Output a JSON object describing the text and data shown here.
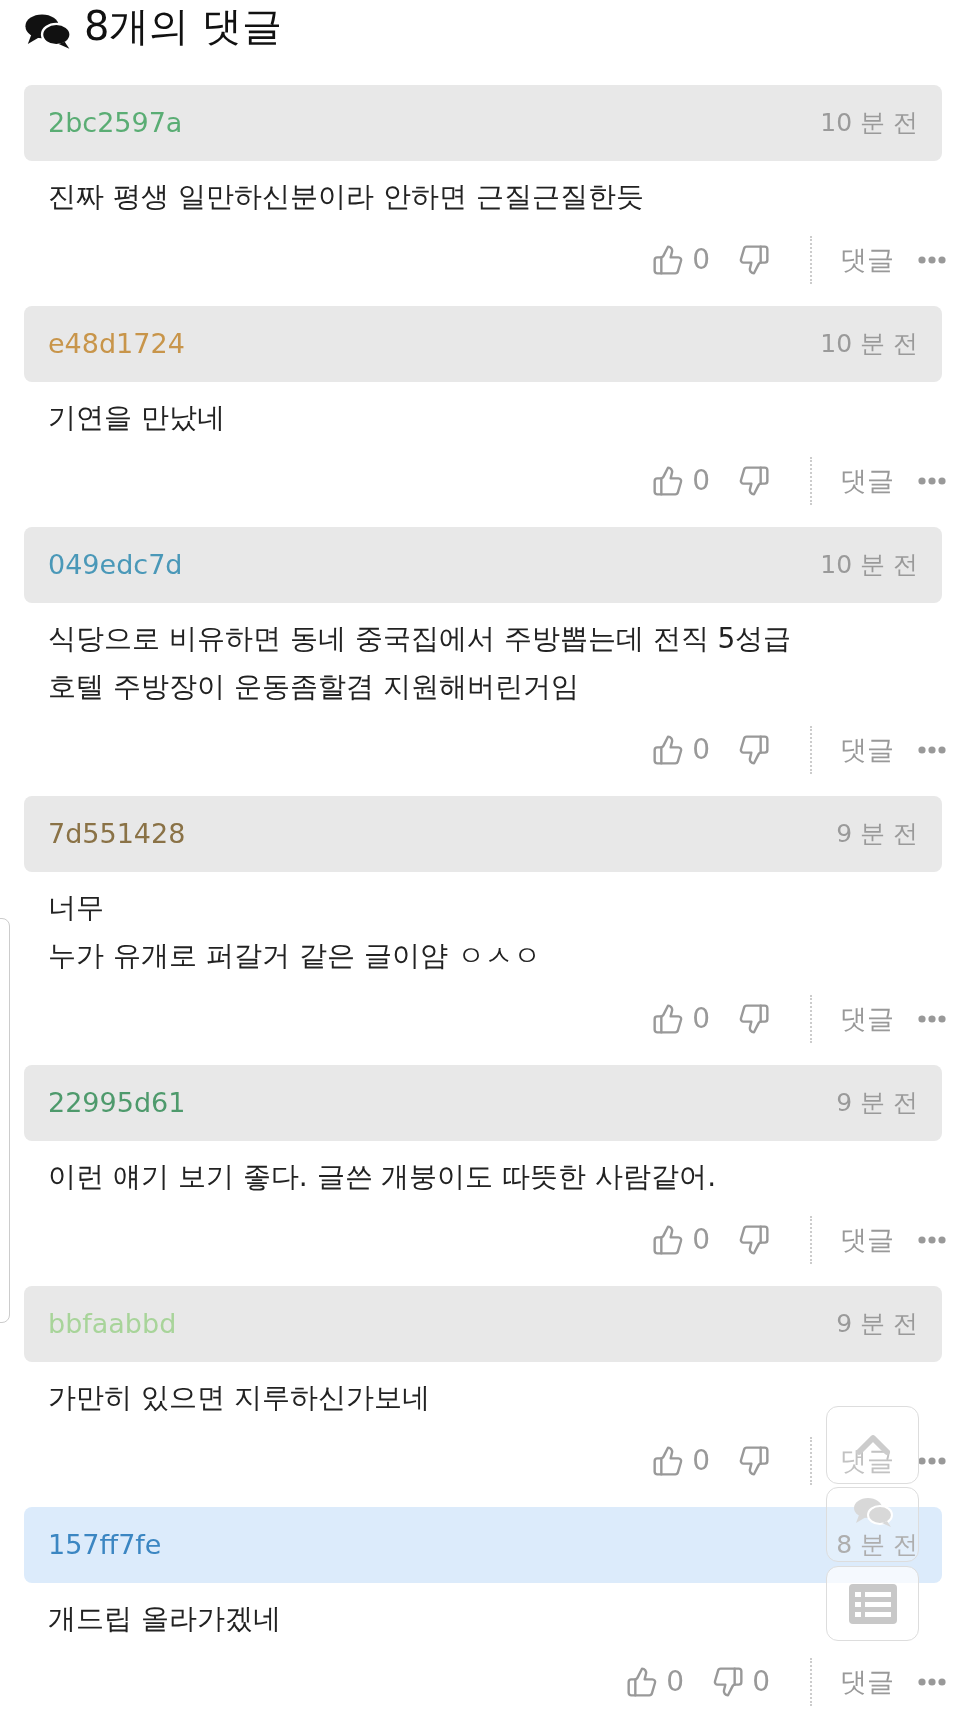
{
  "title": "8개의 댓글",
  "comments": [
    {
      "author": "2bc2597a",
      "color": "#5aad74",
      "time": "10 분 전",
      "selected": false,
      "body": [
        "진짜 평생 일만하신분이라 안하면 근질근질한듯"
      ],
      "likes": "0",
      "reply": "댓글"
    },
    {
      "author": "e48d1724",
      "color": "#c8954a",
      "time": "10 분 전",
      "selected": false,
      "body": [
        "기연을 만났네"
      ],
      "likes": "0",
      "reply": "댓글"
    },
    {
      "author": "049edc7d",
      "color": "#4a98b8",
      "time": "10 분 전",
      "selected": false,
      "body": [
        "식당으로 비유하면 동네 중국집에서 주방뽑는데 전직 5성급호텔 주방장이 운동좀할겸 지원해버린거임"
      ],
      "likes": "0",
      "reply": "댓글"
    },
    {
      "author": "7d551428",
      "color": "#8a7246",
      "time": "9 분 전",
      "selected": false,
      "body": [
        "너무",
        "누가 유개로 퍼갈거 같은 글이얌 ㅇㅅㅇ"
      ],
      "likes": "0",
      "reply": "댓글"
    },
    {
      "author": "22995d61",
      "color": "#4e9a6c",
      "time": "9 분 전",
      "selected": false,
      "body": [
        "이런 얘기 보기 좋다. 글쓴 개붕이도 따뜻한 사람같어."
      ],
      "likes": "0",
      "reply": "댓글"
    },
    {
      "author": "bbfaabbd",
      "color": "#a8d49a",
      "time": "9 분 전",
      "selected": false,
      "body": [
        "가만히 있으면 지루하신가보네"
      ],
      "likes": "0",
      "reply": "댓글"
    },
    {
      "author": "157ff7fe",
      "color": "#3b86c2",
      "time": "8 분 전",
      "selected": true,
      "body": [
        "개드립 올라가겠네"
      ],
      "likes": "0",
      "dislikes": "0",
      "reply": "댓글"
    }
  ]
}
